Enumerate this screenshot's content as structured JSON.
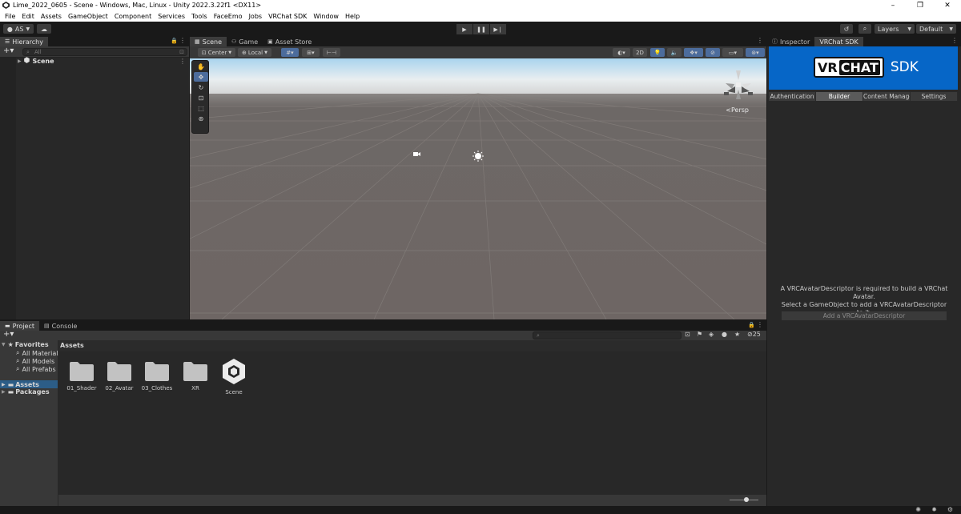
{
  "window": {
    "title": "Lime_2022_0605 - Scene - Windows, Mac, Linux - Unity 2022.3.22f1 <DX11>",
    "min": "–",
    "max": "❐",
    "close": "✕"
  },
  "menu": [
    "File",
    "Edit",
    "Assets",
    "GameObject",
    "Component",
    "Services",
    "Tools",
    "FaceEmo",
    "Jobs",
    "VRChat SDK",
    "Window",
    "Help"
  ],
  "toolbar": {
    "account": "AS",
    "layers": "Layers",
    "layout": "Default"
  },
  "hierarchy": {
    "tab": "Hierarchy",
    "search_placeholder": "All",
    "scene_item": "Scene"
  },
  "scene": {
    "tabs": [
      "Scene",
      "Game",
      "Asset Store"
    ],
    "pivot": "Center",
    "space": "Local",
    "mode_2d": "2D",
    "persp": "Persp"
  },
  "inspector": {
    "tabs": [
      "Inspector",
      "VRChat SDK"
    ],
    "logo_left": "VR",
    "logo_chat": "CHAT",
    "logo_sdk": "SDK",
    "sdk_tabs": [
      "Authentication",
      "Builder",
      "Content Manager",
      "Settings"
    ],
    "message_line1": "A VRCAvatarDescriptor is required to build a VRChat",
    "message_line2": "Avatar.",
    "message_line3": "Select a GameObject to add a VRCAvatarDescriptor to it.",
    "add_button": "Add a VRCAvatarDescriptor"
  },
  "project": {
    "tabs": [
      "Project",
      "Console"
    ],
    "favorites": "Favorites",
    "fav_items": [
      "All Materials",
      "All Models",
      "All Prefabs"
    ],
    "assets_root": "Assets",
    "packages_root": "Packages",
    "assets_header": "Assets",
    "count": "25",
    "items": [
      {
        "name": "01_Shader",
        "kind": "folder"
      },
      {
        "name": "02_Avatar",
        "kind": "folder"
      },
      {
        "name": "03_Clothes",
        "kind": "folder"
      },
      {
        "name": "XR",
        "kind": "folder"
      },
      {
        "name": "Scene",
        "kind": "scene"
      }
    ]
  },
  "colors": {
    "accent_blue": "#0666c7",
    "panel_bg": "#282828",
    "toolbar_bg": "#383838"
  }
}
